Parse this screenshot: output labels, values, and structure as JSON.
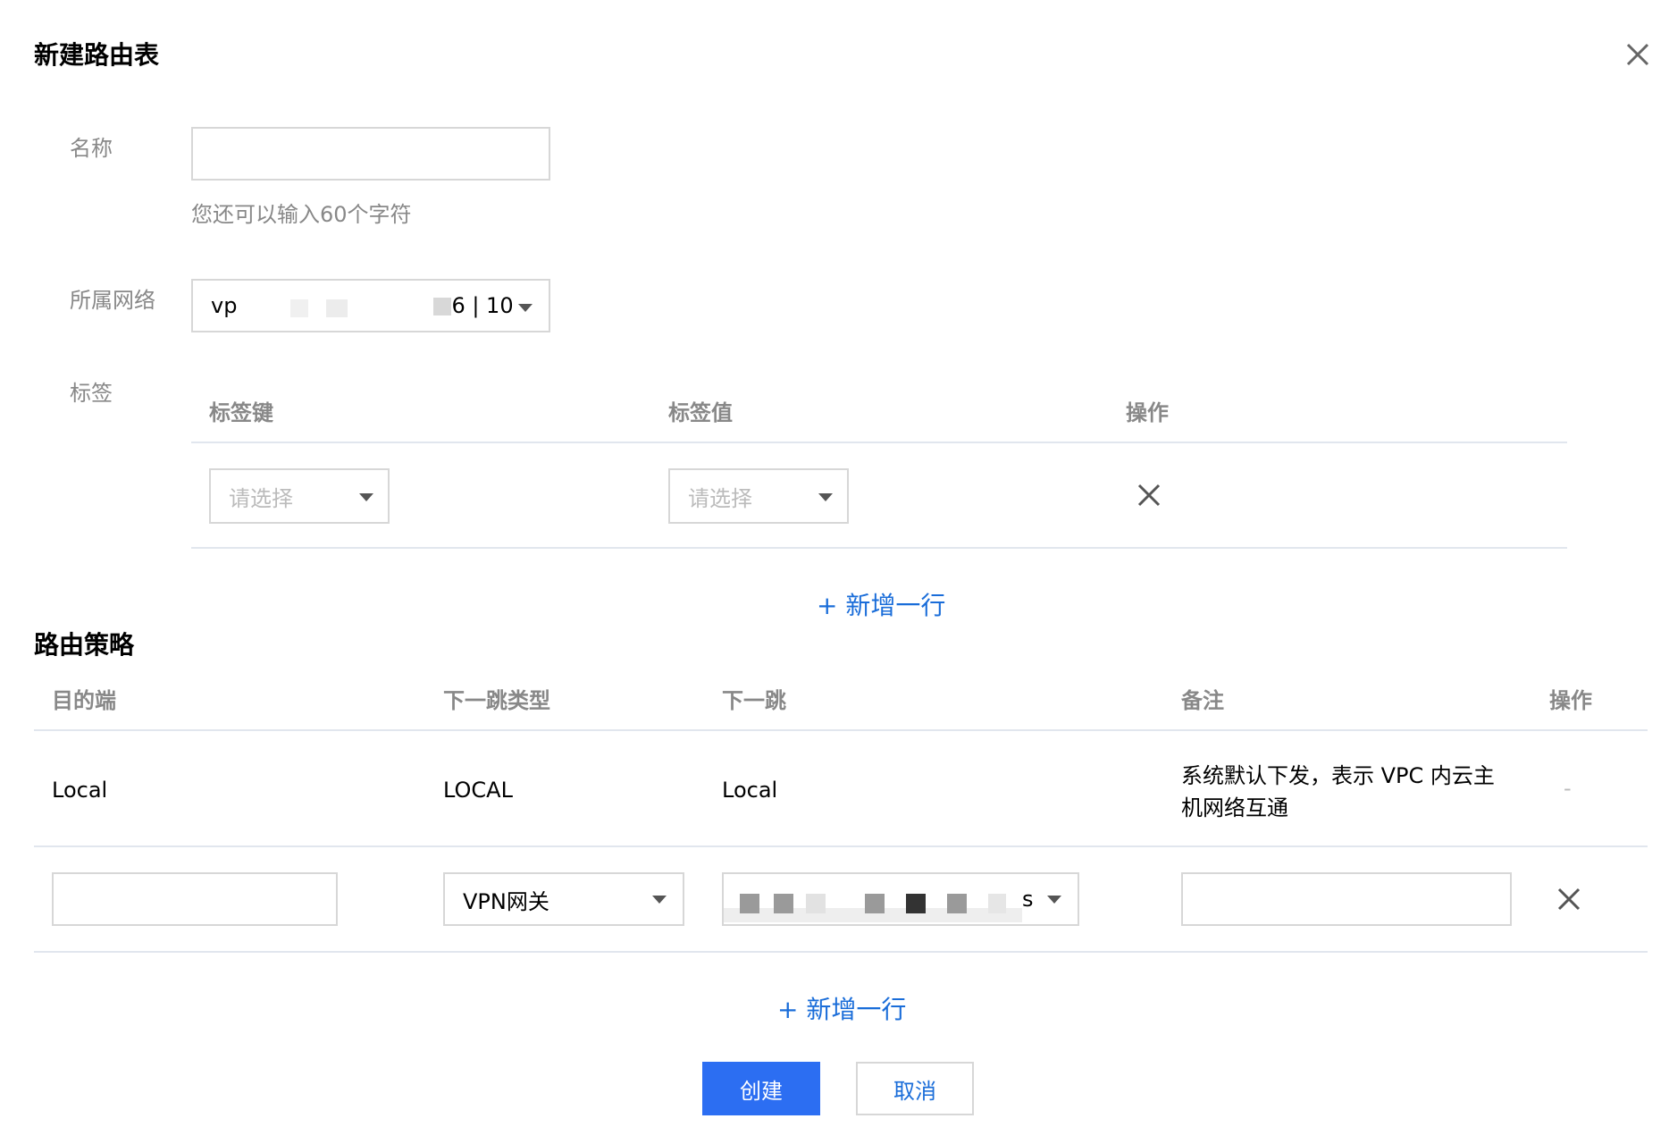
{
  "dialog": {
    "title": "新建路由表"
  },
  "form": {
    "name_label": "名称",
    "name_value": "",
    "name_hint": "您还可以输入60个字符",
    "vpc_label": "所属网络",
    "vpc_prefix": "vp",
    "vpc_suffix": "6 | 10",
    "tags_label": "标签"
  },
  "tags_table": {
    "headers": [
      "标签键",
      "标签值",
      "操作"
    ],
    "row": {
      "key_placeholder": "请选择",
      "value_placeholder": "请选择"
    },
    "add_row": "+ 新增一行"
  },
  "route_section": {
    "title": "路由策略",
    "headers": [
      "目的端",
      "下一跳类型",
      "下一跳",
      "备注",
      "操作"
    ],
    "rows": [
      {
        "destination": "Local",
        "next_hop_type": "LOCAL",
        "next_hop": "Local",
        "remark_line1": "系统默认下发，表示 VPC 内云主",
        "remark_line2": "机网络互通",
        "action": "-"
      }
    ],
    "edit_row": {
      "destination_value": "",
      "next_hop_type": "VPN网关",
      "next_hop_suffix": "s",
      "remark_value": ""
    },
    "add_row": "+ 新增一行"
  },
  "footer": {
    "create_label": "创建",
    "cancel_label": "取消"
  },
  "colors": {
    "primary": "#2c6ef2",
    "link": "#1a6dd9",
    "border": "#d7d7d7",
    "muted": "#888888"
  }
}
